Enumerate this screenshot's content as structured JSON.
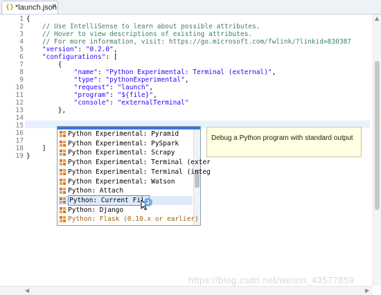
{
  "tab": {
    "icon": "{}",
    "title": "*launch.json",
    "close": "✕"
  },
  "editor": {
    "lines": [
      {
        "n": "1",
        "text": "{"
      },
      {
        "n": "2",
        "text": "    // Use IntelliSense to learn about possible attributes."
      },
      {
        "n": "3",
        "text": "    // Hover to view descriptions of existing attributes."
      },
      {
        "n": "4",
        "text": "    // For more information, visit: https://go.microsoft.com/fwlink/?linkid=830387"
      },
      {
        "n": "5",
        "text": "    \"version\": \"0.2.0\","
      },
      {
        "n": "6",
        "text": "    \"configurations\": ["
      },
      {
        "n": "7",
        "text": "        {"
      },
      {
        "n": "8",
        "text": "            \"name\": \"Python Experimental: Terminal (external)\","
      },
      {
        "n": "9",
        "text": "            \"type\": \"pythonExperimental\","
      },
      {
        "n": "10",
        "text": "            \"request\": \"launch\","
      },
      {
        "n": "11",
        "text": "            \"program\": \"${file}\","
      },
      {
        "n": "12",
        "text": "            \"console\": \"externalTerminal\""
      },
      {
        "n": "13",
        "text": "        },"
      },
      {
        "n": "14",
        "text": ""
      },
      {
        "n": "15",
        "text": ""
      },
      {
        "n": "16",
        "text": ""
      },
      {
        "n": "17",
        "text": ""
      },
      {
        "n": "18",
        "text": "    ]"
      },
      {
        "n": "19",
        "text": "}"
      }
    ]
  },
  "completion": {
    "items": [
      "Python Experimental: Pyramid",
      "Python Experimental: PySpark",
      "Python Experimental: Scrapy",
      "Python Experimental: Terminal (exter",
      "Python Experimental: Terminal (integ",
      "Python Experimental: Watson",
      "Python: Attach",
      "Python: Current File",
      "Python: Django",
      "Python: Flask (0.10.x or earlier)"
    ],
    "selected_index": 7,
    "item_icon": "template-icon"
  },
  "tooltip": {
    "text": "Debug a Python program with standard output"
  },
  "watermark": "https://blog.csdn.net/weixin_43577859",
  "colors": {
    "comment": "#3f7f5f",
    "string": "#2a00ff",
    "selection": "#dfeaf8",
    "tooltip_bg": "#ffffe1"
  }
}
